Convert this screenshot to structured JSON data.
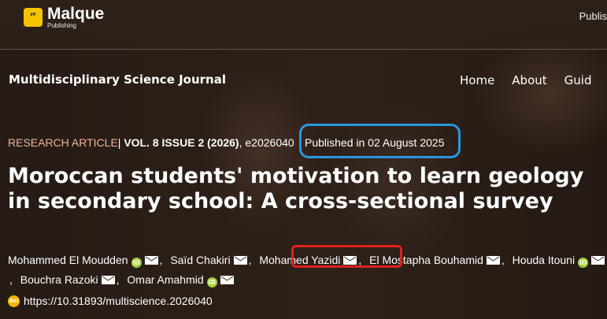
{
  "header": {
    "logo_mark": "”",
    "logo_name": "Malque",
    "logo_sub": "Publishing",
    "top_right_text": "Publis"
  },
  "journal_title": "Multidisciplinary Science Journal",
  "nav": {
    "items": [
      "Home",
      "About",
      "Guid"
    ]
  },
  "article": {
    "type": "RESEARCH ARTICLE",
    "divider": "|",
    "volume": "VOL. 8 ISSUE 2 (2026)",
    "article_id": ", e2026040",
    "published": "Published in 02 August 2025",
    "title": "Moroccan students' motivation to learn geology in secondary school: A cross-sectional survey"
  },
  "authors": [
    "Mohammed El Moudden",
    "Saïd Chakiri",
    "Mohamed Yazidi",
    "El Mostapha Bouhamid",
    "Houda Itouni",
    "Bouchra Razoki",
    "Omar Amahmid"
  ],
  "author_separator": ",",
  "icons": {
    "orcid_glyph": "iD",
    "doi_glyph": "doi",
    "orcid_color": "#a6ce39",
    "doi_color": "#f4b400"
  },
  "highlight_colors": {
    "published_box": "#2a96df",
    "author_box": "#e0201c"
  },
  "doi": "https://10.31893/multiscience.2026040"
}
